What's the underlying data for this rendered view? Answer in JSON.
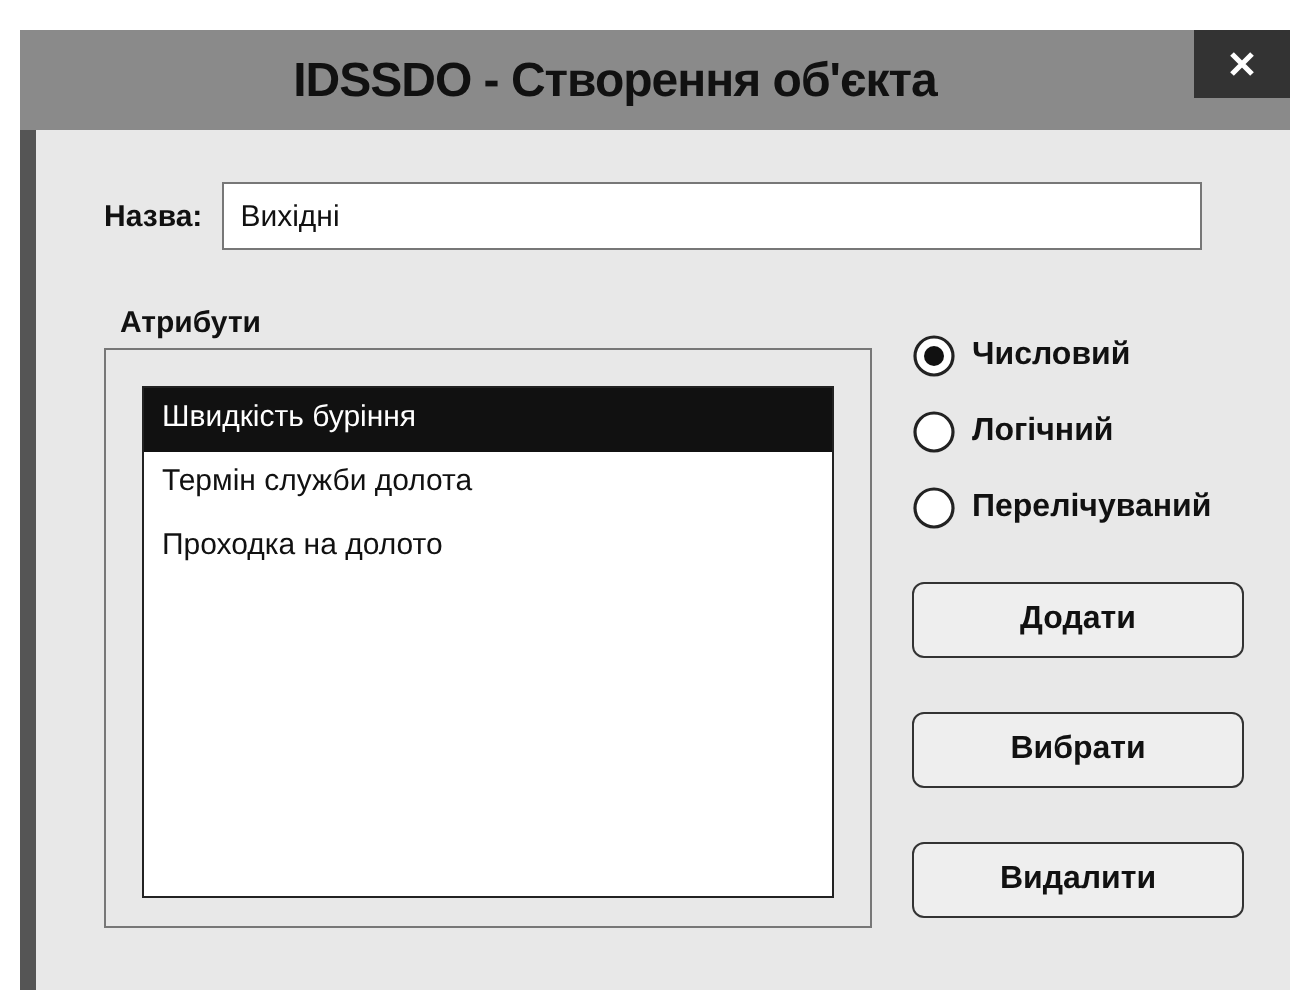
{
  "window": {
    "title": "IDSSDO - Створення об'єкта"
  },
  "name_field": {
    "label": "Назва:",
    "value": "Вихідні"
  },
  "attributes": {
    "label": "Атрибути",
    "items": [
      {
        "text": "Швидкість буріння",
        "selected": true
      },
      {
        "text": "Термін служби долота",
        "selected": false
      },
      {
        "text": "Проходка на долото",
        "selected": false
      }
    ]
  },
  "types": [
    {
      "label": "Числовий",
      "selected": true
    },
    {
      "label": "Логічний",
      "selected": false
    },
    {
      "label": "Перелічуваний",
      "selected": false
    }
  ],
  "buttons": [
    "Додати",
    "Вибрати",
    "Видалити"
  ]
}
